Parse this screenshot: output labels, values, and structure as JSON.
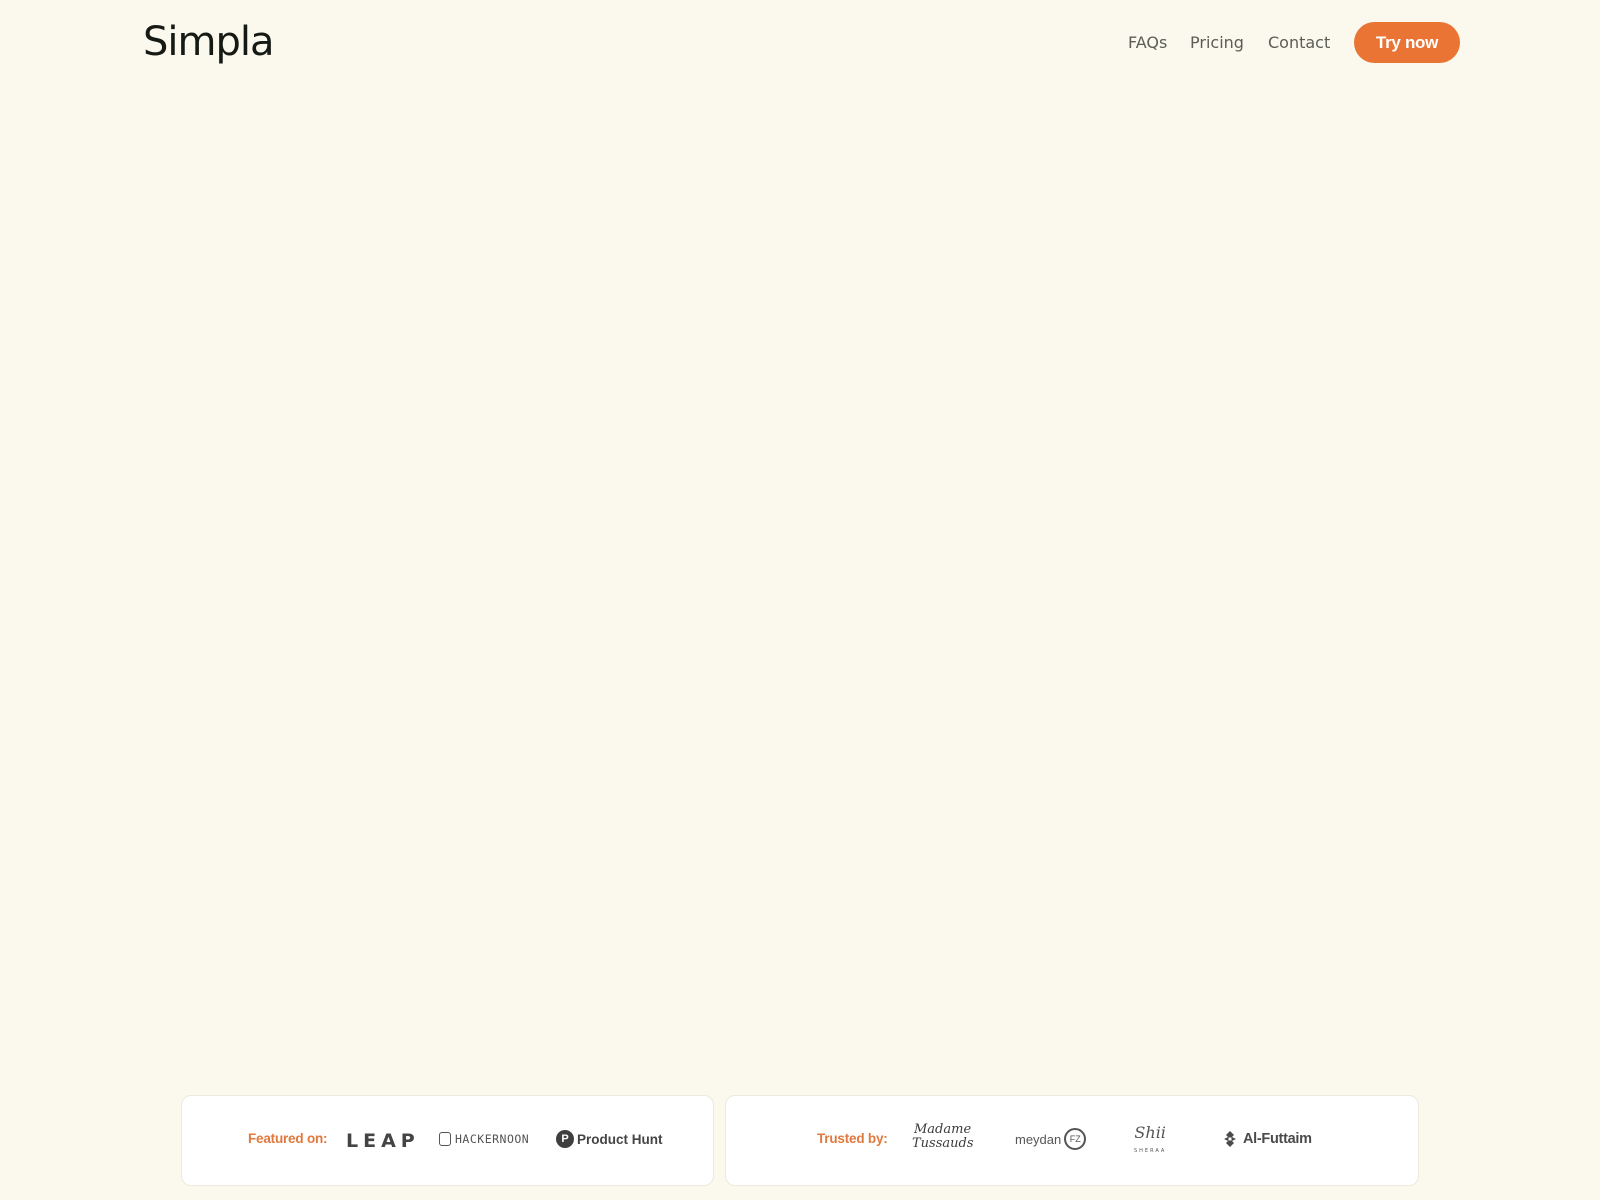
{
  "header": {
    "logo": "Simpla",
    "nav": [
      {
        "label": "FAQs"
      },
      {
        "label": "Pricing"
      },
      {
        "label": "Contact"
      }
    ],
    "cta_label": "Try now"
  },
  "featured": {
    "label": "Featured on:",
    "brands": [
      {
        "name": "LEAP",
        "icon": "leap-logo"
      },
      {
        "name": "HACKERNOON",
        "icon": "hackernoon-helmet-icon"
      },
      {
        "name": "Product Hunt",
        "icon": "product-hunt-p-icon",
        "icon_glyph": "P"
      }
    ]
  },
  "trusted": {
    "label": "Trusted by:",
    "brands": [
      {
        "name_line1": "Madame",
        "name_line2": "Tussauds",
        "icon": "madame-tussauds-logo"
      },
      {
        "name": "meydan",
        "badge": "FZ",
        "icon": "meydan-fz-logo"
      },
      {
        "name": "Shii",
        "sub": "SHERAA",
        "icon": "sheraa-logo"
      },
      {
        "name": "Al-Futtaim",
        "icon": "al-futtaim-emblem-icon"
      }
    ]
  },
  "colors": {
    "background": "#fbf8ed",
    "accent": "#e97434",
    "card": "#ffffff",
    "nav_text": "#5b5d57"
  }
}
